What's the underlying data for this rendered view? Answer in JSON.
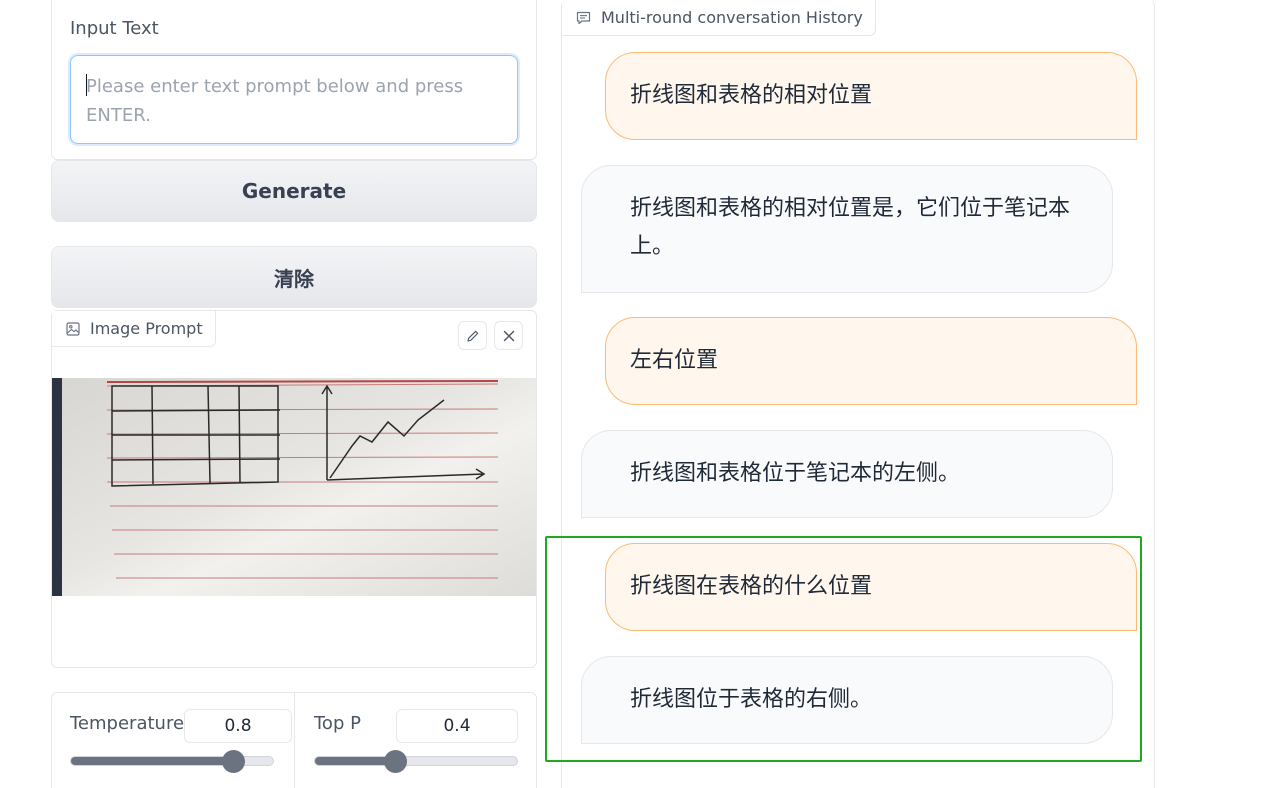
{
  "input": {
    "label": "Input Text",
    "placeholder": "Please enter text prompt below and press ENTER.",
    "value": ""
  },
  "buttons": {
    "generate": "Generate",
    "clear": "清除"
  },
  "image_prompt": {
    "label": "Image Prompt",
    "icon": "image-icon",
    "edit_icon": "pencil-icon",
    "close_icon": "close-icon"
  },
  "params": {
    "temperature": {
      "label": "Temperature",
      "value": "0.8",
      "fraction": 0.8
    },
    "top_p": {
      "label": "Top P",
      "value": "0.4",
      "fraction": 0.4
    }
  },
  "chat": {
    "label": "Multi-round conversation History",
    "icon": "chat-icon",
    "messages": [
      {
        "role": "user",
        "text": "折线图和表格的相对位置"
      },
      {
        "role": "bot",
        "text": "折线图和表格的相对位置是，它们位于笔记本上。"
      },
      {
        "role": "user",
        "text": "左右位置"
      },
      {
        "role": "bot",
        "text": "折线图和表格位于笔记本的左侧。"
      },
      {
        "role": "user",
        "text": "折线图在表格的什么位置"
      },
      {
        "role": "bot",
        "text": "折线图位于表格的右侧。"
      }
    ]
  },
  "colors": {
    "user_bubble": "#fff7ed",
    "user_border": "#fdba74",
    "bot_bubble": "#f9fafb",
    "highlight": "#22a722",
    "focus": "#93c5fd"
  }
}
